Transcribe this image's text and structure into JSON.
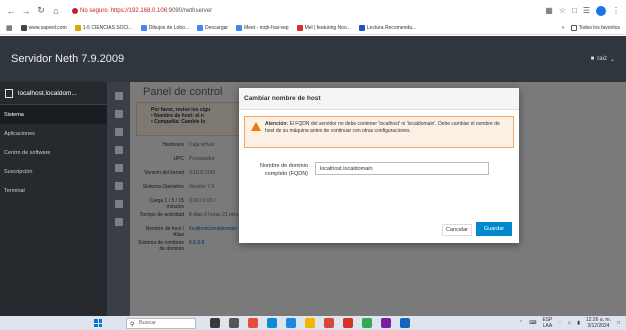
{
  "browser": {
    "security_label": "No seguro",
    "url_host": "https://192.168.0.106",
    "url_path": ":9090/nethserver"
  },
  "bookmarks": {
    "items": [
      {
        "label": "www.sapred.com",
        "color": "#444"
      },
      {
        "label": "1-5 CIENCIAS SOCI...",
        "color": "#e0a800"
      },
      {
        "label": "Dibujos de Lobo...",
        "color": "#4285f4"
      },
      {
        "label": "Descargar",
        "color": "#4285f4"
      },
      {
        "label": "Meet - mqh-fxai-vep",
        "color": "#4285f4"
      },
      {
        "label": "Mel | featuring Noo...",
        "color": "#d93025"
      },
      {
        "label": "Lectura Recomenda...",
        "color": "#1a56b8"
      }
    ],
    "more": "»",
    "all_favorites": "Todos los favoritos"
  },
  "app": {
    "title": "Servidor Neth 7.9.2009",
    "user": "raiz"
  },
  "sidebar": {
    "host": "localhost.localdom...",
    "items": [
      {
        "label": "Sistema",
        "active": true
      },
      {
        "label": "Aplicaciones",
        "active": false
      },
      {
        "label": "Centro de software",
        "active": false
      },
      {
        "label": "Suscripción",
        "active": false
      },
      {
        "label": "Terminal",
        "active": false
      }
    ]
  },
  "main": {
    "title": "Panel de control",
    "alert": {
      "line1": "Por favor, revise los sigu",
      "line2": "• Nombre de host: el n",
      "line3": "• Compañía: Cambie lo"
    },
    "info": [
      {
        "key": "Hardware",
        "value": "Caja virtual"
      },
      {
        "key": "UPC",
        "value": "Procesador"
      },
      {
        "key": "Versión del kernel",
        "value": "3.10.0-1160"
      },
      {
        "key": "Sistema Operativo",
        "value": "Versión 7.9"
      },
      {
        "key": "Carga 1 / 5 / 15 minutos",
        "value": "0.00 / 0.03 /"
      },
      {
        "key": "Tiempo de actividad",
        "value": "8 días 0 horas 21 minutos 7 segundos"
      },
      {
        "key": "Nombre de host / Alias",
        "value": "localhost.localdomain"
      },
      {
        "key": "Sistema de nombres de dominio",
        "value": "8.8.8.8"
      }
    ]
  },
  "modal": {
    "title": "Cambiar nombre de host",
    "alert_bold": "Atención:",
    "alert_text": " El FQDN del servidor no debe contener 'localhost' ni 'localdomain'. Debe cambiar el nombre de host de su máquina antes de continuar con otras configuraciones.",
    "field_label": "Nombre de dominio completo (FQDN)",
    "field_value": "localhost.localdomain",
    "cancel_label": "Cancelar",
    "save_label": "Guardar"
  },
  "taskbar": {
    "search_placeholder": "Buscar",
    "lang": "ESP",
    "lang2": "LAA",
    "time": "12:26 a. m.",
    "date": "3/12/2024"
  }
}
